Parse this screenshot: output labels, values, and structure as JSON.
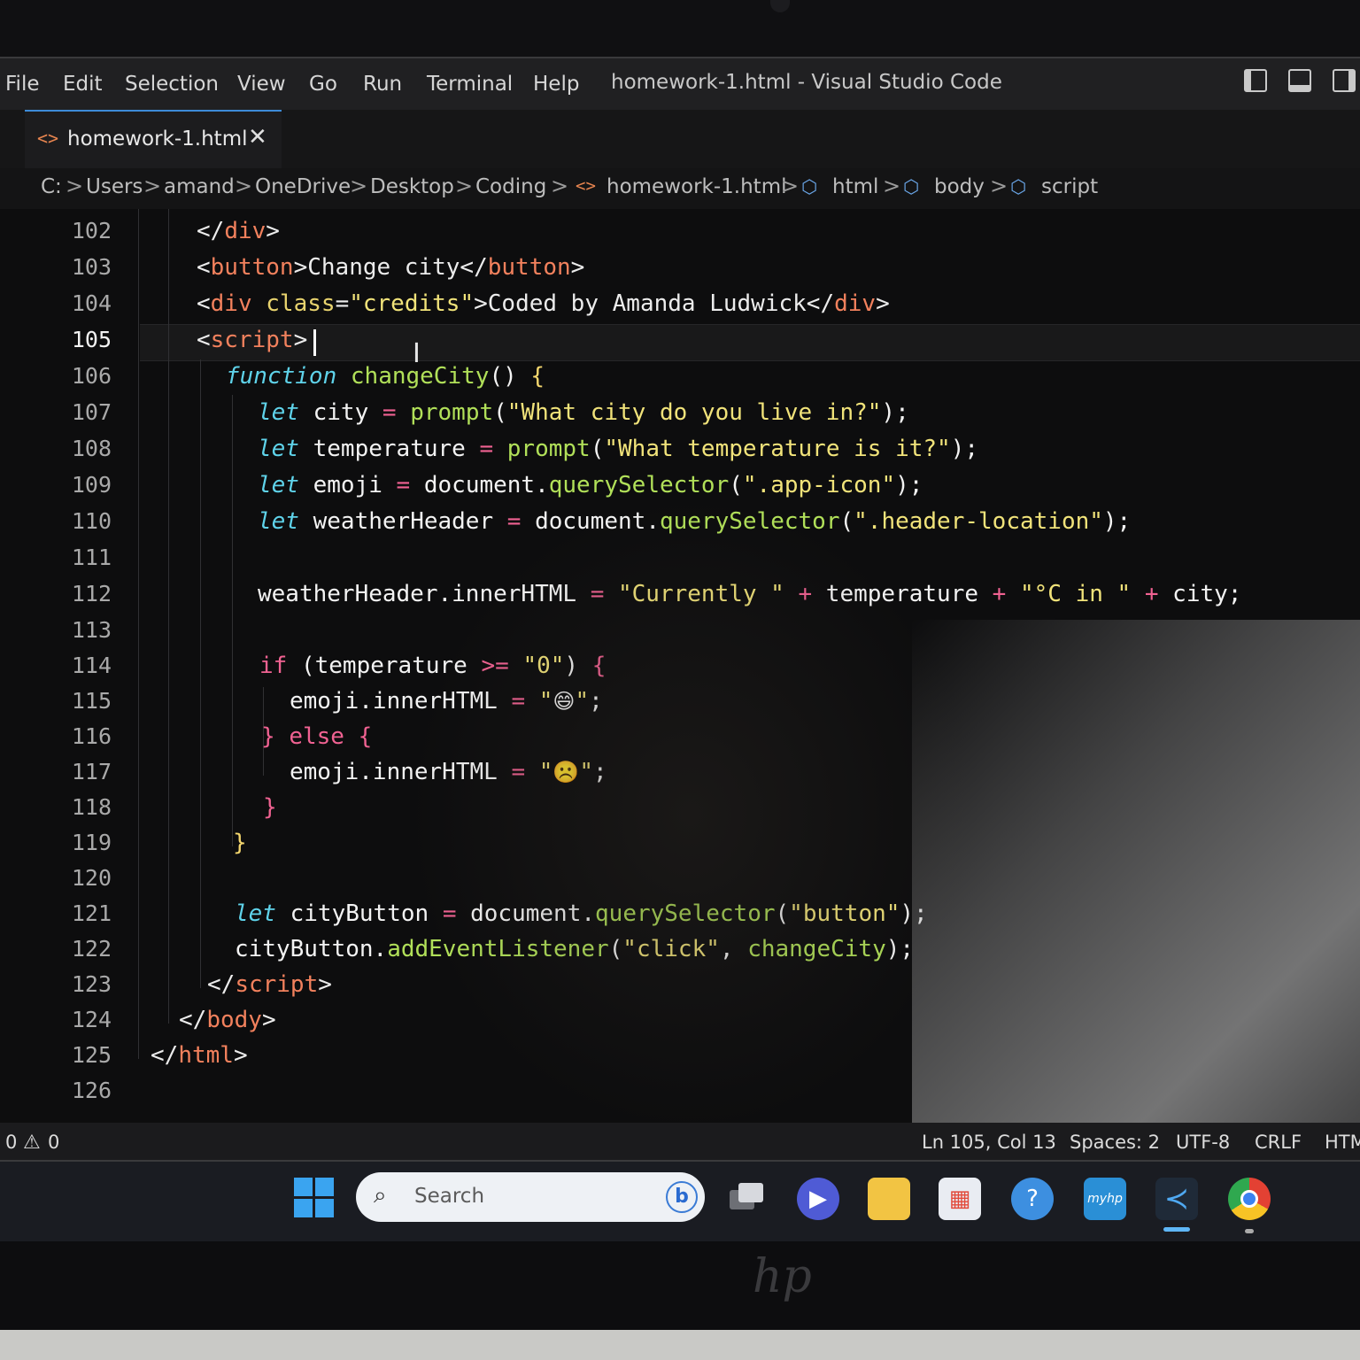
{
  "menu": {
    "items": [
      "File",
      "Edit",
      "Selection",
      "View",
      "Go",
      "Run",
      "Terminal",
      "Help"
    ],
    "window_title": "homework-1.html - Visual Studio Code"
  },
  "tab": {
    "icon": "<>",
    "label": "homework-1.html",
    "close": "✕"
  },
  "breadcrumb": {
    "items": [
      "C:",
      "Users",
      "amand",
      "OneDrive",
      "Desktop",
      "Coding",
      "homework-1.html",
      "html",
      "body",
      "script"
    ],
    "separator": ">"
  },
  "editor": {
    "line_numbers": [
      "102",
      "103",
      "104",
      "105",
      "106",
      "107",
      "108",
      "109",
      "110",
      "111",
      "112",
      "113",
      "114",
      "115",
      "116",
      "117",
      "118",
      "119",
      "120",
      "121",
      "122",
      "123",
      "124",
      "125",
      "126"
    ],
    "current_line": "105",
    "code": {
      "l102": [
        "</",
        "div",
        ">"
      ],
      "l103": [
        "<",
        "button",
        ">Change city</",
        "button",
        ">"
      ],
      "l104": [
        "<",
        "div",
        " ",
        "class",
        "=",
        "\"credits\"",
        ">Coded by Amanda Ludwick</",
        "div",
        ">"
      ],
      "l105": [
        "<",
        "script",
        ">"
      ],
      "l106": [
        "function",
        " ",
        "changeCity",
        "() ",
        "{"
      ],
      "l107": [
        "let",
        " city ",
        "=",
        " ",
        "prompt",
        "(",
        "\"What city do you live in?\"",
        ");"
      ],
      "l108": [
        "let",
        " temperature ",
        "=",
        " ",
        "prompt",
        "(",
        "\"What temperature is it?\"",
        ");"
      ],
      "l109": [
        "let",
        " emoji ",
        "=",
        " document.",
        "querySelector",
        "(",
        "\".app-icon\"",
        ");"
      ],
      "l110": [
        "let",
        " weatherHeader ",
        "=",
        " document.",
        "querySelector",
        "(",
        "\".header-location\"",
        ");"
      ],
      "l112": [
        "weatherHeader.innerHTML ",
        "=",
        " ",
        "\"Currently \"",
        " ",
        "+",
        " temperature ",
        "+",
        " ",
        "\"°C in \"",
        " ",
        "+",
        " city;"
      ],
      "l114": [
        "if",
        " (temperature ",
        ">=",
        " ",
        "\"0\"",
        ") ",
        "{"
      ],
      "l115": [
        "emoji.innerHTML ",
        "=",
        " ",
        "\"",
        "😄",
        "\"",
        ";"
      ],
      "l116": [
        "}",
        " ",
        "else",
        " ",
        "{"
      ],
      "l117": [
        "emoji.innerHTML ",
        "=",
        " ",
        "\"",
        "☹️",
        "\"",
        ";"
      ],
      "l118": [
        "}"
      ],
      "l119": [
        "}"
      ],
      "l121": [
        "let",
        " cityButton ",
        "=",
        " document.",
        "querySelector",
        "(",
        "\"button\"",
        ");"
      ],
      "l122": [
        "cityButton.",
        "addEventListener",
        "(",
        "\"click\"",
        ", ",
        "changeCity",
        ");"
      ],
      "l123": [
        "</",
        "script",
        ">"
      ],
      "l124": [
        "</",
        "body",
        ">"
      ],
      "l125": [
        "</",
        "html",
        ">"
      ]
    }
  },
  "status": {
    "errors": "0",
    "warnings": "0",
    "warning_icon": "warning-triangle-icon",
    "position": "Ln 105, Col 13",
    "spaces": "Spaces: 2",
    "encoding": "UTF-8",
    "eol": "CRLF",
    "language": "HTM"
  },
  "taskbar": {
    "search_placeholder": "Search",
    "bing_label": "b",
    "myhp_label": "myhp",
    "icons": [
      "windows-start-icon",
      "task-view-icon",
      "chat-icon",
      "file-explorer-icon",
      "microsoft-store-icon",
      "get-help-icon",
      "myhp-icon",
      "vscode-icon",
      "chrome-icon"
    ]
  },
  "device": {
    "brand": "hp"
  },
  "colors": {
    "tag_name": "#f2815d",
    "string": "#f1e37a",
    "keyword": "#5fd3ea",
    "function": "#b1e059",
    "operator": "#f06292",
    "accent": "#3d8bd8"
  }
}
